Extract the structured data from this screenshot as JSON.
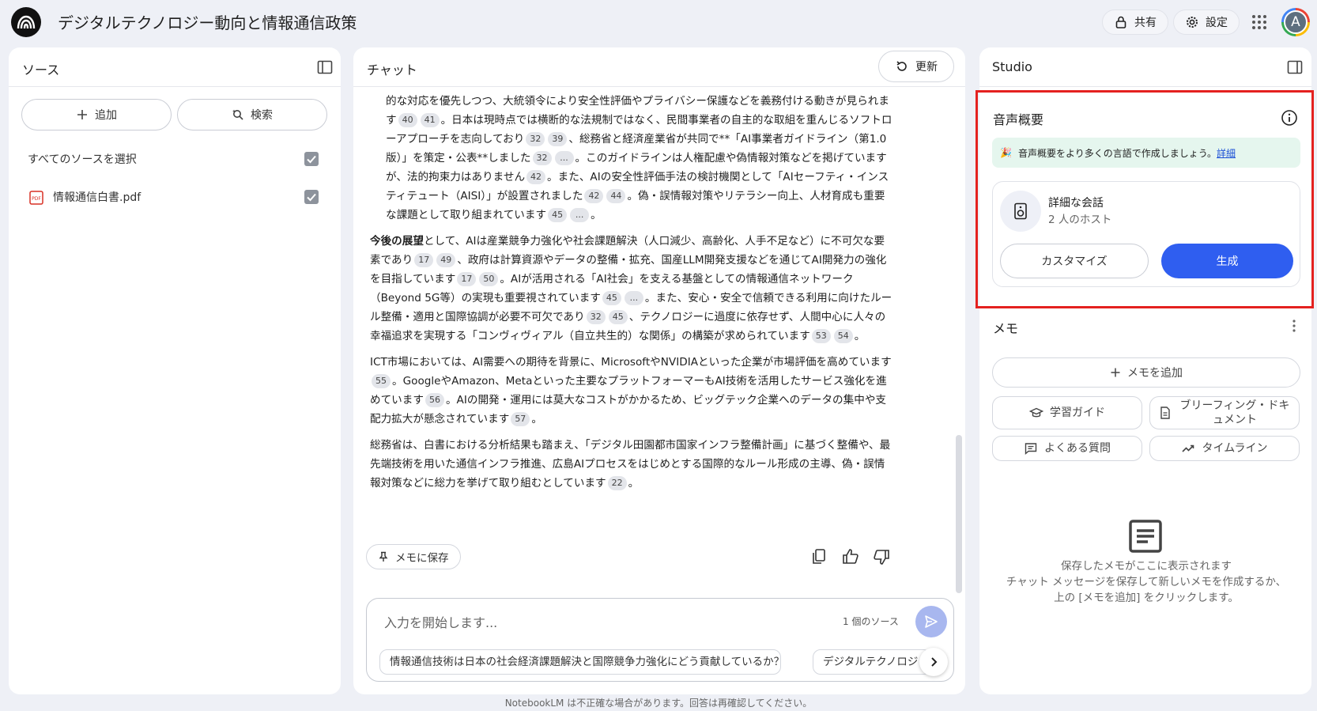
{
  "header": {
    "title": "デジタルテクノロジー動向と情報通信政策",
    "share_label": "共有",
    "settings_label": "設定",
    "avatar_initial": "A"
  },
  "sources": {
    "title": "ソース",
    "add_label": "追加",
    "search_label": "検索",
    "select_all_label": "すべてのソースを選択",
    "items": [
      {
        "name": "情報通信白書.pdf",
        "checked": true
      }
    ]
  },
  "chat": {
    "title": "チャット",
    "refresh_label": "更新",
    "save_memo_label": "メモに保存",
    "input_placeholder": "入力を開始します...",
    "source_count": "1 個のソース",
    "suggestions": [
      "情報通信技術は日本の社会経済課題解決と国際競争力強化にどう貢献しているか？",
      "デジタルテクノロジ"
    ],
    "p1": {
      "a": "的な対応を優先しつつ、大統領令により安全性評価やプライバシー保護などを義務付ける動きが見られます",
      "c1": "40",
      "c2": "41",
      "b": "。日本は現時点では横断的な法規制ではなく、民間事業者の自主的な取組を重んじるソフトローアプローチを志向しており",
      "c3": "32",
      "c4": "39",
      "c": "、総務省と経済産業省が共同で**「AI事業者ガイドライン（第1.0版）」を策定・公表**しました",
      "c5": "32",
      "c6": "...",
      "d": "。このガイドラインは人権配慮や偽情報対策などを掲げていますが、法的拘束力はありません",
      "c7": "42",
      "e": "。また、AIの安全性評価手法の検討機関として「AIセーフティ・インスティテュート（AISI）」が設置されました",
      "c8": "42",
      "c9": "44",
      "f": "。偽・誤情報対策やリテラシー向上、人材育成も重要な課題として取り組まれています",
      "c10": "45",
      "c11": "...",
      "g": "。"
    },
    "p2": {
      "bold": "今後の展望",
      "a": "として、AIは産業競争力強化や社会課題解決（人口減少、高齢化、人手不足など）に不可欠な要素であり",
      "c1": "17",
      "c2": "49",
      "b": "、政府は計算資源やデータの整備・拡充、国産LLM開発支援などを通じてAI開発力の強化を目指しています",
      "c3": "17",
      "c4": "50",
      "c": "。AIが活用される「AI社会」を支える基盤としての情報通信ネットワーク（Beyond 5G等）の実現も重要視されています",
      "c5": "45",
      "c6": "...",
      "d": "。また、安心・安全で信頼できる利用に向けたルール整備・適用と国際協調が必要不可欠であり",
      "c7": "32",
      "c8": "45",
      "e": "、テクノロジーに過度に依存せず、人間中心に人々の幸福追求を実現する「コンヴィヴィアル（自立共生的）な関係」の構築が求められています",
      "c9": "53",
      "c10": "54",
      "f": "。"
    },
    "p3": {
      "a": "ICT市場においては、AI需要への期待を背景に、MicrosoftやNVIDIAといった企業が市場評価を高めています",
      "c1": "55",
      "b": "。GoogleやAmazon、Metaといった主要なプラットフォーマーもAI技術を活用したサービス強化を進めています",
      "c2": "56",
      "c": "。AIの開発・運用には莫大なコストがかかるため、ビッグテック企業へのデータの集中や支配力拡大が懸念されています",
      "c3": "57",
      "d": "。"
    },
    "p4": {
      "a": "総務省は、白書における分析結果も踏まえ、「デジタル田園都市国家インフラ整備計画」に基づく整備や、最先端技術を用いた通信インフラ推進、広島AIプロセスをはじめとする国際的なルール形成の主導、偽・誤情報対策などに総力を挙げて取り組むとしています",
      "c1": "22",
      "b": "。"
    }
  },
  "studio": {
    "title": "Studio",
    "audio_overview": {
      "title": "音声概要",
      "banner_emoji": "🎉",
      "banner_text": "音声概要をより多くの言語で作成しましょう。",
      "banner_link": "詳細",
      "format_title": "詳細な会話",
      "format_subtitle": "2 人のホスト",
      "customize_label": "カスタマイズ",
      "generate_label": "生成"
    },
    "memo": {
      "title": "メモ",
      "add_label": "メモを追加",
      "chips": {
        "study_guide": "学習ガイド",
        "briefing_doc": "ブリーフィング・ドキュメント",
        "faq": "よくある質問",
        "timeline": "タイムライン"
      },
      "empty_line1": "保存したメモがここに表示されます",
      "empty_line2": "チャット メッセージを保存して新しいメモを作成するか、",
      "empty_line3": "上の [メモを追加] をクリックします。"
    }
  },
  "footer": {
    "disclaimer": "NotebookLM は不正確な場合があります。回答は再確認してください。"
  },
  "colors": {
    "primary": "#2f5ef0",
    "highlight_border": "#e4211f",
    "banner_bg": "#e5f6ee",
    "page_bg": "#eef0f6"
  }
}
